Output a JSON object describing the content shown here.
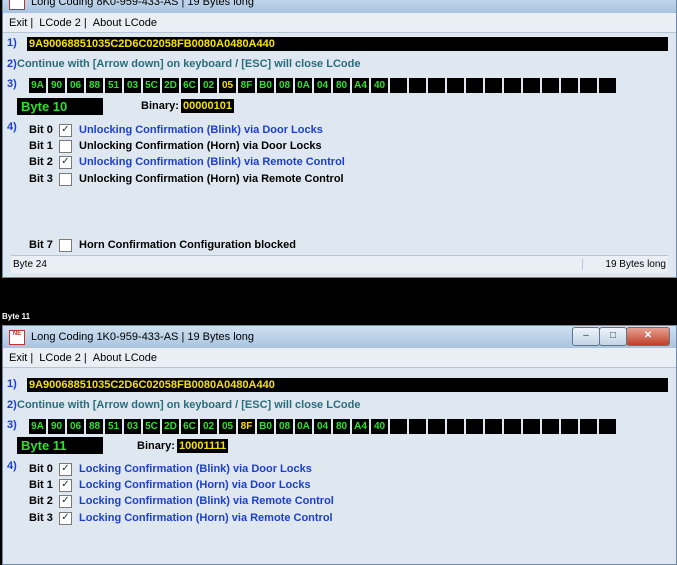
{
  "window1": {
    "title": "Long Coding 8K0-959-433-AS | 19 Bytes long",
    "menu": [
      "Exit |",
      "LCode 2 |",
      "About LCode"
    ],
    "code": "9A90068851035C2D6C02058FB0080A0480A440",
    "hint": "Continue with [Arrow down] on keyboard / [ESC] will close LCode",
    "bytes": [
      "9A",
      "90",
      "06",
      "88",
      "51",
      "03",
      "5C",
      "2D",
      "6C",
      "02",
      "05",
      "8F",
      "B0",
      "08",
      "0A",
      "04",
      "80",
      "A4",
      "40",
      "",
      "",
      "",
      "",
      "",
      "",
      "",
      "",
      "",
      "",
      "",
      ""
    ],
    "selected_byte_index": 10,
    "byte_label": "Byte 10",
    "binary_label": "Binary:",
    "binary": "00000101",
    "bits": [
      {
        "label": "Bit 0",
        "checked": true,
        "text": "Unlocking Confirmation (Blink) via Door Locks",
        "active": true
      },
      {
        "label": "Bit 1",
        "checked": false,
        "text": "Unlocking Confirmation (Horn) via Door Locks",
        "active": false
      },
      {
        "label": "Bit 2",
        "checked": true,
        "text": "Unlocking Confirmation (Blink) via Remote Control",
        "active": true
      },
      {
        "label": "Bit 3",
        "checked": false,
        "text": "Unlocking Confirmation (Horn) via Remote Control",
        "active": false
      },
      {
        "label": "Bit 7",
        "checked": false,
        "text": "Horn Confirmation Configuration blocked",
        "active": false
      }
    ],
    "status_left": "Byte 24",
    "status_right": "19 Bytes long"
  },
  "caption": "Byte 11",
  "window2": {
    "title": "Long Coding  1K0-959-433-AS | 19 Bytes long",
    "menu": [
      "Exit |",
      "LCode 2 |",
      "About LCode"
    ],
    "code": "9A90068851035C2D6C02058FB0080A0480A440",
    "hint": "Continue with [Arrow down] on keyboard / [ESC] will close LCode",
    "bytes": [
      "9A",
      "90",
      "06",
      "88",
      "51",
      "03",
      "5C",
      "2D",
      "6C",
      "02",
      "05",
      "8F",
      "B0",
      "08",
      "0A",
      "04",
      "80",
      "A4",
      "40",
      "",
      "",
      "",
      "",
      "",
      "",
      "",
      "",
      "",
      "",
      "",
      ""
    ],
    "selected_byte_index": 11,
    "byte_label": "Byte 11",
    "binary_label": "Binary:",
    "binary": "10001111",
    "bits": [
      {
        "label": "Bit 0",
        "checked": true,
        "text": "Locking Confirmation (Blink) via Door Locks",
        "active": true
      },
      {
        "label": "Bit 1",
        "checked": true,
        "text": "Locking Confirmation (Horn) via Door Locks",
        "active": true
      },
      {
        "label": "Bit 2",
        "checked": true,
        "text": "Locking Confirmation (Blink) via Remote Control",
        "active": true
      },
      {
        "label": "Bit 3",
        "checked": true,
        "text": "Locking Confirmation (Horn) via Remote Control",
        "active": true
      }
    ]
  },
  "section_numbers": [
    "1)",
    "2)",
    "3)",
    "4)"
  ],
  "logo_text": "NE-Tech"
}
